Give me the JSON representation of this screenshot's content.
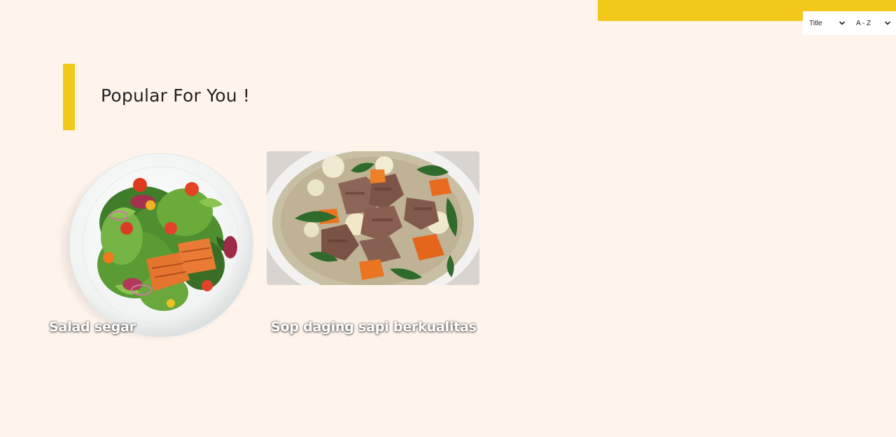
{
  "theme": {
    "background": "#fff4ec",
    "accent": "#f2c81b",
    "text": "#222222"
  },
  "sort": {
    "field": "Title",
    "order": "A - Z",
    "chevron_icon": "chevron-down-icon"
  },
  "section": {
    "title": "Popular For You !"
  },
  "cards": [
    {
      "title": "Salad segar",
      "image": "salmon-salad-plate"
    },
    {
      "title": "Sop daging sapi berkualitas",
      "image": "beef-vegetable-soup-bowl"
    }
  ]
}
